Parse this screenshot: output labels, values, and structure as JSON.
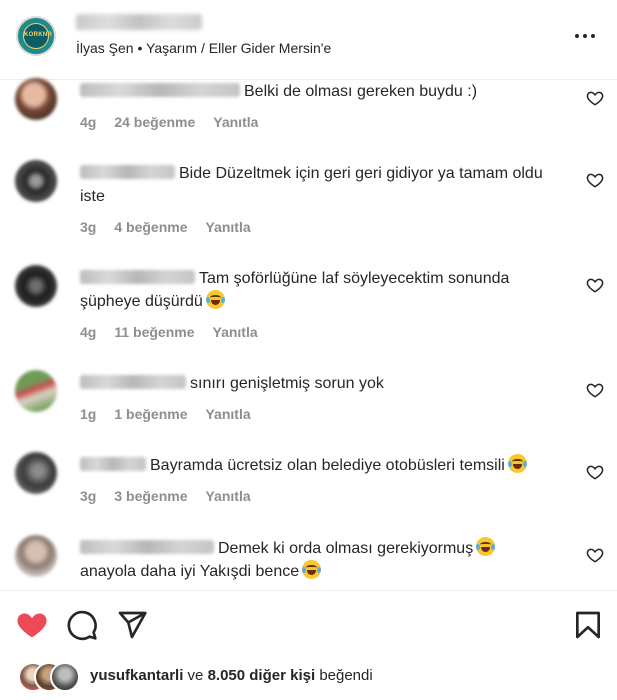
{
  "header": {
    "subtitle": "İlyas Şen • Yaşarım / Eller Gider Mersin'e",
    "avatar_text": "KORKNR"
  },
  "comments": [
    {
      "text": "Belki de olması gereken buydu :)",
      "emoji": "",
      "time": "4g",
      "likes": "24 beğenme",
      "reply": "Yanıtla"
    },
    {
      "text": "Bide Düzeltmek için geri geri gidiyor ya tamam oldu iste",
      "emoji": "",
      "time": "3g",
      "likes": "4 beğenme",
      "reply": "Yanıtla"
    },
    {
      "text": "Tam şoförlüğüne laf söyleyecektim sonunda şüpheye düşürdü",
      "emoji": "joy-emoji",
      "time": "4g",
      "likes": "11 beğenme",
      "reply": "Yanıtla"
    },
    {
      "text": "sınırı genişletmiş sorun yok",
      "emoji": "",
      "time": "1g",
      "likes": "1 beğenme",
      "reply": "Yanıtla"
    },
    {
      "text": "Bayramda ücretsiz olan belediye otobüsleri temsili",
      "emoji": "joy-emoji",
      "time": "3g",
      "likes": "3 beğenme",
      "reply": "Yanıtla"
    },
    {
      "text_1": "Demek ki orda olması gerekiyormuş",
      "text_2": "anayola daha iyi Yakışdi bence",
      "emoji": "joy-emoji",
      "time": "",
      "likes": "",
      "reply": ""
    }
  ],
  "footer": {
    "liker_name": "yusufkantarli",
    "connector": "ve",
    "others": "8.050 diğer kişi",
    "liked_suffix": "beğendi",
    "icons": [
      "heart-filled-icon",
      "comment-icon",
      "share-icon",
      "bookmark-icon"
    ],
    "like_color": "#ed4956"
  }
}
